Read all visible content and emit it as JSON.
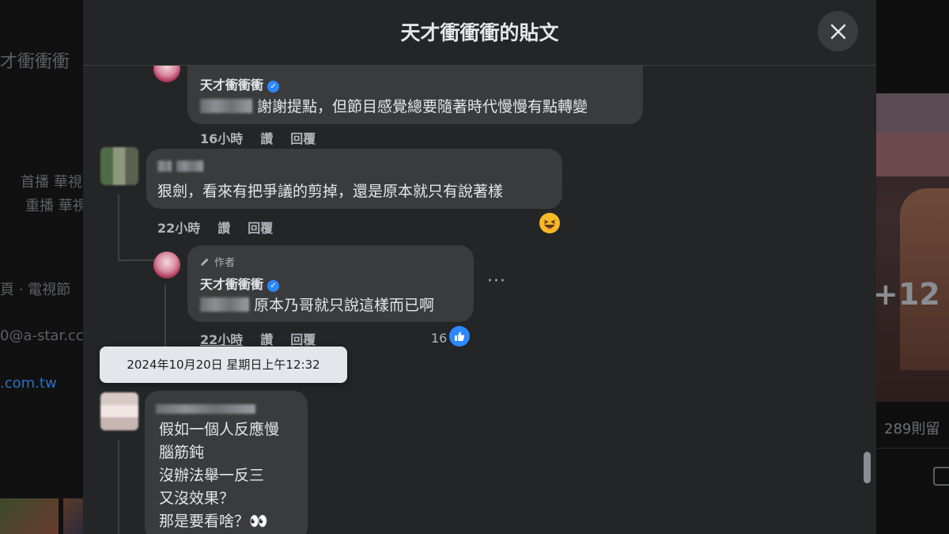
{
  "modal": {
    "title": "天才衝衝衝的貼文",
    "close_label": "×"
  },
  "background": {
    "left_texts": [
      "才衝衝衝",
      "首播 華視",
      "重播 華視",
      "頁 · 電視節",
      "0@a-star.cc",
      ".com.tw"
    ],
    "photo_overlay": "+12",
    "comments_count": "289則留"
  },
  "comments": [
    {
      "name": "天才衝衝衝",
      "verified": true,
      "text": "謝謝提點，但節目感覺總要隨著時代慢慢有點轉變",
      "time": "16小時",
      "like_label": "讚",
      "reply_label": "回覆"
    },
    {
      "name": "",
      "text": "狠劍，看來有把爭議的剪掉，還是原本就只有說著樣",
      "time": "22小時",
      "like_label": "讚",
      "reply_label": "回覆",
      "reaction": "grinning-squinting-face"
    },
    {
      "author_tag": "作者",
      "name": "天才衝衝衝",
      "verified": true,
      "text": "原本乃哥就只說這樣而已啊",
      "time": "22小時",
      "like_label": "讚",
      "reply_label": "回覆",
      "like_count": "16",
      "more": "···"
    },
    {
      "name": "",
      "lines": [
        "假如一個人反應慢",
        "腦筋鈍",
        "沒辦法舉一反三",
        "又沒效果？",
        "那是要看啥？👀"
      ]
    }
  ],
  "tooltip": "2024年10月20日 星期日上午12:32",
  "colors": {
    "modal_bg": "#242526",
    "bubble_bg": "#3a3b3c",
    "verified_blue": "#2d88ff",
    "secondary_text": "#b0b3b8"
  }
}
